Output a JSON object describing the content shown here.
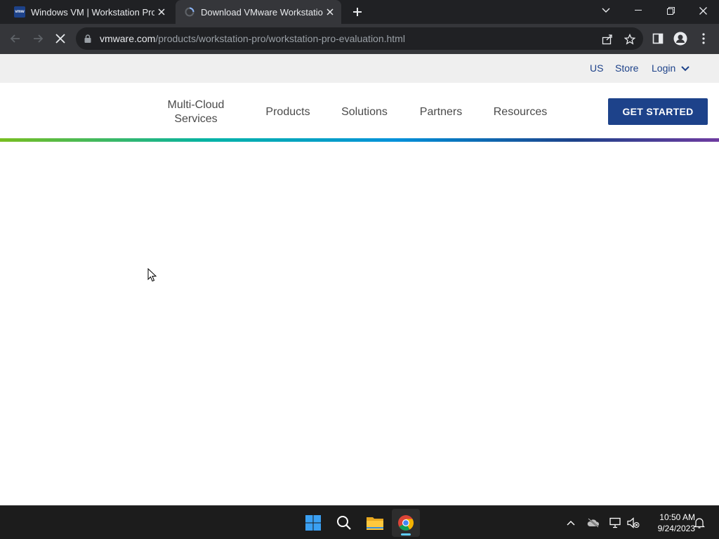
{
  "browser": {
    "tabs": [
      {
        "title": "Windows VM | Workstation Pro | VMware",
        "favicon": "vmw-logo",
        "favicon_text": "vmw",
        "active": false
      },
      {
        "title": "Download VMware Workstation Pro",
        "favicon": "loading-spinner-icon",
        "active": true
      }
    ],
    "address_bar": {
      "host": "vmware.com",
      "path": "/products/workstation-pro/workstation-pro-evaluation.html"
    }
  },
  "page": {
    "utility_links": {
      "region": "US",
      "store": "Store",
      "login": "Login"
    },
    "nav": {
      "multicloud_line1": "Multi-Cloud",
      "multicloud_line2": "Services",
      "products": "Products",
      "solutions": "Solutions",
      "partners": "Partners",
      "resources": "Resources",
      "cta": "GET STARTED"
    }
  },
  "taskbar": {
    "clock_time": "10:50 AM",
    "clock_date": "9/24/2023"
  },
  "colors": {
    "brand_blue": "#1d428a",
    "chrome_dark": "#202124",
    "chrome_toolbar": "#35363a"
  }
}
